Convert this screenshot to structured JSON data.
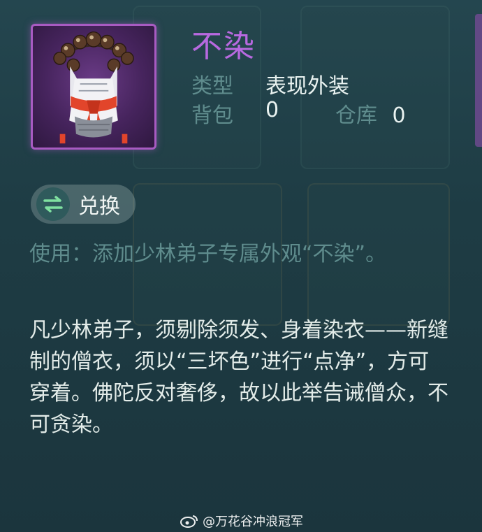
{
  "item": {
    "name": "不染",
    "type_label": "类型",
    "type_value": "表现外装",
    "bag_label": "背包",
    "bag_value": "0",
    "storage_label": "仓库",
    "storage_value": "0",
    "icon": "monk-robe-with-prayer-beads-icon",
    "rarity_color": "#a85bc2"
  },
  "action": {
    "label": "兑换",
    "icon": "exchange-arrows-icon"
  },
  "usage_text": "使用：添加少林弟子专属外观“不染”。",
  "description": "凡少林弟子，须剔除须发、身着染衣——新缝制的僧衣，须以“三坏色”进行“点净”，方可穿着。佛陀反对奢侈，故以此举告诫僧众，不可贪染。",
  "watermark": {
    "text": "@万花谷冲浪冠军",
    "icon": "weibo-icon"
  },
  "colors": {
    "background": "#1f3a42",
    "name": "#b869e0",
    "label": "#5f8c8d",
    "value": "#e9f2f0"
  }
}
